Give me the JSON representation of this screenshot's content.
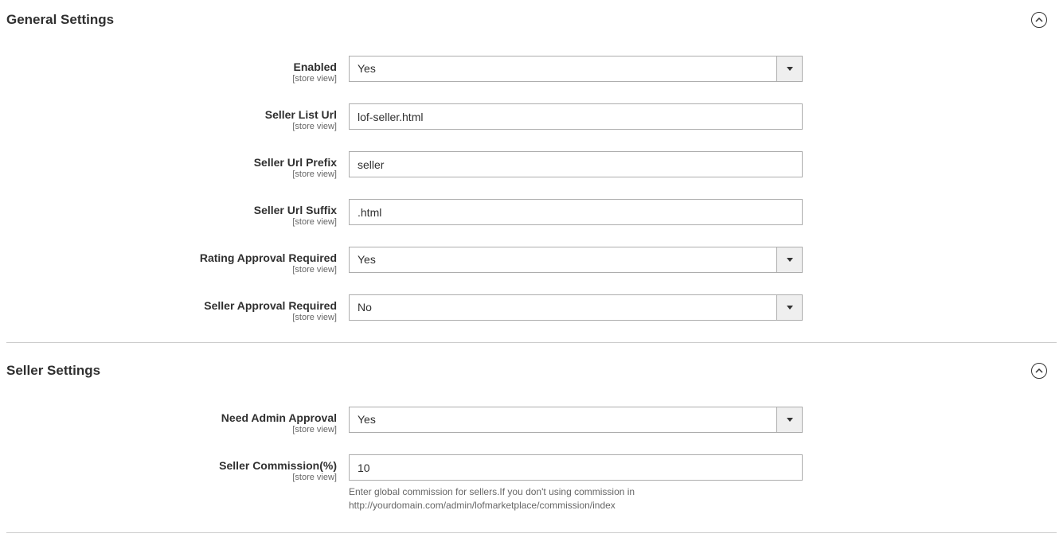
{
  "sections": {
    "general": {
      "title": "General Settings",
      "scope_label": "[store view]",
      "fields": {
        "enabled": {
          "label": "Enabled",
          "value": "Yes"
        },
        "seller_list_url": {
          "label": "Seller List Url",
          "value": "lof-seller.html"
        },
        "seller_url_prefix": {
          "label": "Seller Url Prefix",
          "value": "seller"
        },
        "seller_url_suffix": {
          "label": "Seller Url Suffix",
          "value": ".html"
        },
        "rating_approval": {
          "label": "Rating Approval Required",
          "value": "Yes"
        },
        "seller_approval": {
          "label": "Seller Approval Required",
          "value": "No"
        }
      }
    },
    "seller": {
      "title": "Seller Settings",
      "scope_label": "[store view]",
      "fields": {
        "need_admin_approval": {
          "label": "Need Admin Approval",
          "value": "Yes"
        },
        "seller_commission": {
          "label": "Seller Commission(%)",
          "value": "10",
          "help": "Enter global commission for sellers.If you don't using commission in http://yourdomain.com/admin/lofmarketplace/commission/index"
        }
      }
    }
  }
}
